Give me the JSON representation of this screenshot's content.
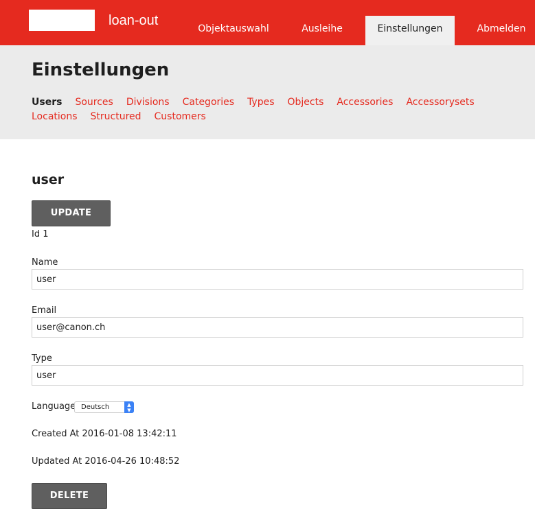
{
  "app": {
    "brand": "loan-out"
  },
  "nav": {
    "items": [
      {
        "label": "Objektauswahl"
      },
      {
        "label": "Ausleihe"
      },
      {
        "label": "Einstellungen"
      },
      {
        "label": "Abmelden"
      }
    ]
  },
  "page": {
    "title": "Einstellungen"
  },
  "subnav": {
    "items": [
      {
        "label": "Users"
      },
      {
        "label": "Sources"
      },
      {
        "label": "Divisions"
      },
      {
        "label": "Categories"
      },
      {
        "label": "Types"
      },
      {
        "label": "Objects"
      },
      {
        "label": "Accessories"
      },
      {
        "label": "Accessorysets"
      },
      {
        "label": "Locations"
      },
      {
        "label": "Structured"
      },
      {
        "label": "Customers"
      }
    ]
  },
  "record": {
    "title": "user",
    "update_label": "UPDATE",
    "id_text": "Id 1",
    "name_label": "Name",
    "name_value": "user",
    "email_label": "Email",
    "email_value": "user@canon.ch",
    "type_label": "Type",
    "type_value": "user",
    "language_label": "Language",
    "language_value": "Deutsch",
    "created_text": "Created At 2016-01-08 13:42:11",
    "updated_text": "Updated At 2016-04-26 10:48:52",
    "delete_label": "DELETE"
  },
  "colors": {
    "brand_red": "#e52a1f",
    "button_gray": "#5f5f5f"
  }
}
